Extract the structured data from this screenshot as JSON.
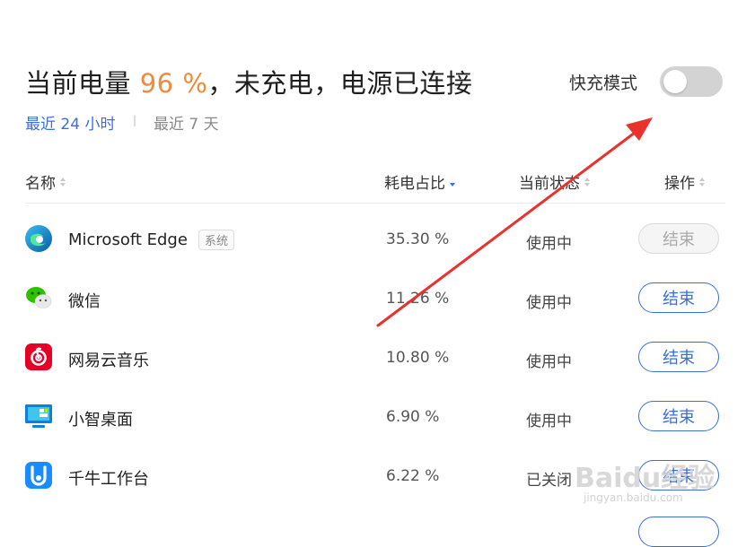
{
  "header": {
    "title_prefix": "当前电量 ",
    "battery_percent": "96 %",
    "title_suffix": "，未充电，电源已连接",
    "fast_charge_label": "快充模式",
    "fast_charge_on": false
  },
  "ranges": [
    {
      "label": "最近 24 小时",
      "active": true
    },
    {
      "label": "最近 7 天",
      "active": false
    }
  ],
  "columns": {
    "name": "名称",
    "usage": "耗电占比",
    "status": "当前状态",
    "action": "操作"
  },
  "rows": [
    {
      "name": "Microsoft Edge",
      "badge": "系统",
      "usage": "35.30 %",
      "status": "使用中",
      "action": "结束",
      "icon": "edge-icon",
      "action_enabled": false
    },
    {
      "name": "微信",
      "usage": "11.26 %",
      "status": "使用中",
      "action": "结束",
      "icon": "wechat-icon",
      "action_enabled": true
    },
    {
      "name": "网易云音乐",
      "usage": "10.80 %",
      "status": "使用中",
      "action": "结束",
      "icon": "netease-music-icon",
      "action_enabled": true
    },
    {
      "name": "小智桌面",
      "usage": "6.90 %",
      "status": "使用中",
      "action": "结束",
      "icon": "desktop-monitor-icon",
      "action_enabled": true
    },
    {
      "name": "千牛工作台",
      "usage": "6.22 %",
      "status": "已关闭",
      "action": "结束",
      "icon": "qianniu-icon",
      "action_enabled": true
    }
  ],
  "watermark": {
    "text": "Baidu经验",
    "sub": "jingyan.baidu.com"
  },
  "colors": {
    "accent": "#3a6fd8",
    "battery": "#f08a3c",
    "arrow": "#e8322d"
  }
}
